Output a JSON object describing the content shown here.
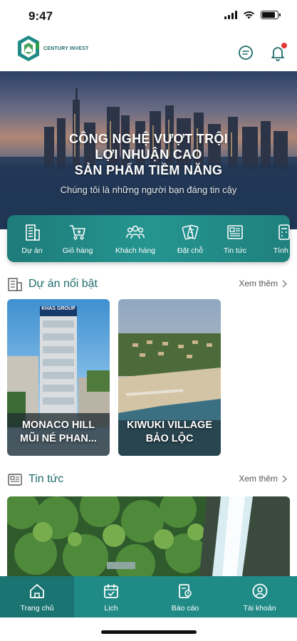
{
  "status_bar": {
    "time": "9:47"
  },
  "header": {
    "logo_text": "CENTURY INVEST",
    "chat_icon": "chat-bubble-icon",
    "notification_icon": "bell-icon"
  },
  "hero": {
    "headline_lines": [
      "CÔNG NGHỆ VƯỢT TRỘI",
      "LỢI NHUẬN CAO",
      "SẢN PHẨM TIỀM NĂNG"
    ],
    "subtitle": "Chúng tôi là những người bạn đáng tin cậy"
  },
  "quick_menu": {
    "items": [
      {
        "label": "Dự án",
        "icon": "building-icon"
      },
      {
        "label": "Giỏ hàng",
        "icon": "cart-icon"
      },
      {
        "label": "Khách hàng",
        "icon": "users-icon"
      },
      {
        "label": "Đặt chỗ",
        "icon": "tickets-icon"
      },
      {
        "label": "Tin tức",
        "icon": "newspaper-icon"
      },
      {
        "label": "Tính l",
        "icon": "calculator-icon"
      }
    ]
  },
  "featured_projects": {
    "title": "Dự án nổi bật",
    "see_more": "Xem thêm",
    "cards": [
      {
        "name_line1": "MONACO HILL",
        "name_line2": "MŨI NÉ PHAN...",
        "sign": "KHAS GROUP"
      },
      {
        "name_line1": "KIWUKI VILLAGE",
        "name_line2": "BẢO LỘC"
      }
    ]
  },
  "news": {
    "title": "Tin tức",
    "see_more": "Xem thêm"
  },
  "bottom_nav": {
    "items": [
      {
        "label": "Trang chủ",
        "icon": "home-icon",
        "active": true
      },
      {
        "label": "Lịch",
        "icon": "calendar-icon",
        "active": false
      },
      {
        "label": "Báo cáo",
        "icon": "report-icon",
        "active": false
      },
      {
        "label": "Tài khoản",
        "icon": "account-icon",
        "active": false
      }
    ]
  },
  "colors": {
    "brand_teal": "#1f8a86",
    "brand_dark_teal": "#1e6c6a",
    "notification_red": "#e53935"
  },
  "status_indicators": {
    "battery_level": 0.85
  }
}
